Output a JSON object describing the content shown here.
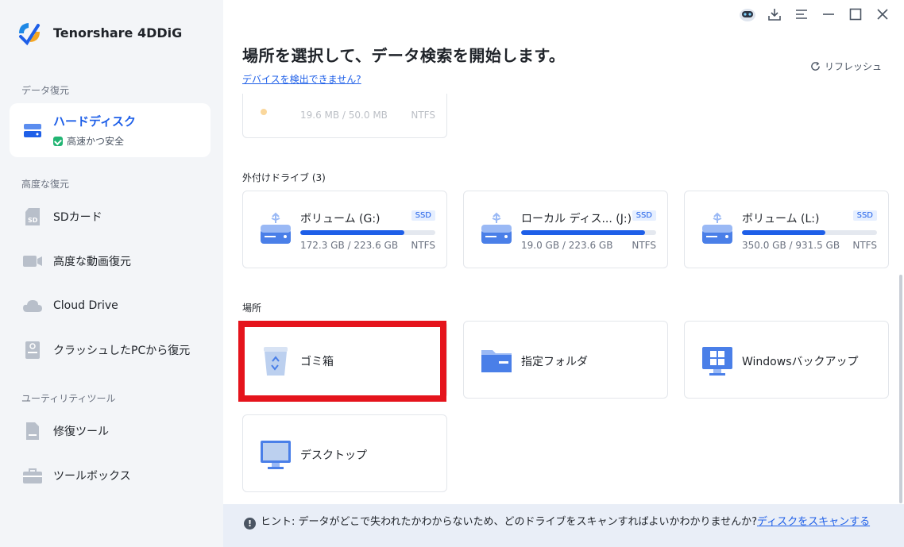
{
  "app": {
    "name": "Tenorshare 4DDiG"
  },
  "sidebar": {
    "section_recovery": "データ復元",
    "hard_disk": {
      "label": "ハードディスク",
      "sub": "高速かつ安全"
    },
    "section_advanced": "高度な復元",
    "advanced_items": [
      {
        "label": "SDカード",
        "icon": "sd-card-icon"
      },
      {
        "label": "高度な動画復元",
        "icon": "video-camera-icon"
      },
      {
        "label": "Cloud Drive",
        "icon": "cloud-icon"
      },
      {
        "label": "クラッシュしたPCから復元",
        "icon": "crashed-pc-icon"
      }
    ],
    "section_utility": "ユーティリティツール",
    "utility_items": [
      {
        "label": "修復ツール",
        "icon": "repair-file-icon"
      },
      {
        "label": "ツールボックス",
        "icon": "toolbox-icon"
      }
    ]
  },
  "main": {
    "title": "場所を選択して、データ検索を開始します。",
    "detect_link": "デバイスを検出できません?",
    "refresh": "リフレッシュ",
    "partial_drive": {
      "size": "19.6 MB / 50.0 MB",
      "fs": "NTFS"
    },
    "external_label": "外付けドライブ (3)",
    "drives": [
      {
        "name": "ボリューム (G:)",
        "badge": "SSD",
        "size": "172.3 GB / 223.6 GB",
        "fs": "NTFS",
        "fill": 0.77
      },
      {
        "name": "ローカル ディス... (J:)",
        "badge": "SSD",
        "size": "19.0 GB / 223.6 GB",
        "fs": "NTFS",
        "fill": 0.92
      },
      {
        "name": "ボリューム (L:)",
        "badge": "SSD",
        "size": "350.0 GB / 931.5 GB",
        "fs": "NTFS",
        "fill": 0.62
      }
    ],
    "location_label": "場所",
    "locations": [
      {
        "name": "ゴミ箱",
        "icon": "recycle-bin-icon"
      },
      {
        "name": "指定フォルダ",
        "icon": "folder-icon"
      },
      {
        "name": "Windowsバックアップ",
        "icon": "windows-backup-icon"
      },
      {
        "name": "デスクトップ",
        "icon": "desktop-icon"
      }
    ]
  },
  "hint": {
    "icon": "!",
    "text": "ヒント: データがどこで失われたかわからないため、どのドライブをスキャンすればよいかわかりませんか?",
    "link": "ディスクをスキャンする"
  },
  "colors": {
    "accent": "#1e5fe8",
    "highlight": "#e5141c",
    "sidebar_bg": "#f3f5f8"
  }
}
